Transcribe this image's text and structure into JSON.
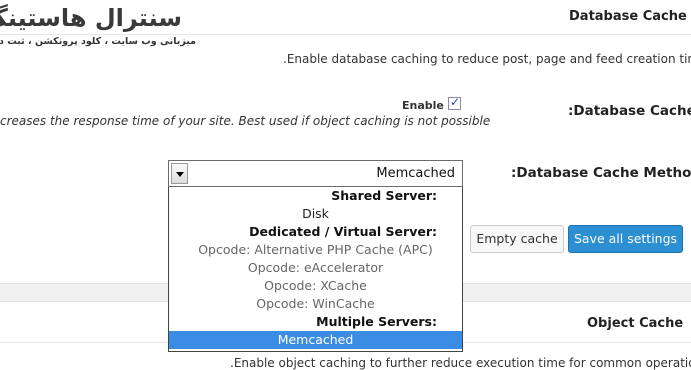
{
  "logo": {
    "main": "سنترال هاستینگ",
    "sub": "میزبانی وب سایت ، کلود پرونکشن ، ثبت دامین"
  },
  "database_cache": {
    "title": "Database Cache",
    "intro": ".Enable database caching to reduce post, page and feed creation time",
    "enable_field_label": ":Database Cache",
    "enable_checkbox_label": "Enable",
    "enable_checked": true,
    "enable_hint": "creases the response time of your site. Best used if object caching is not possible",
    "method_field_label": ":Database Cache Method",
    "method_selected": "Memcached",
    "method_options": [
      {
        "type": "group",
        "label": ":Shared Server"
      },
      {
        "type": "item",
        "label": "Disk",
        "enabled": true
      },
      {
        "type": "group",
        "label": ":Dedicated / Virtual Server"
      },
      {
        "type": "item",
        "label": "(Opcode: Alternative PHP Cache (APC",
        "enabled": false
      },
      {
        "type": "item",
        "label": "Opcode: eAccelerator",
        "enabled": false
      },
      {
        "type": "item",
        "label": "Opcode: XCache",
        "enabled": false
      },
      {
        "type": "item",
        "label": "Opcode: WinCache",
        "enabled": false
      },
      {
        "type": "group",
        "label": ":Multiple Servers"
      },
      {
        "type": "item",
        "label": "Memcached",
        "enabled": true,
        "selected": true
      }
    ]
  },
  "buttons": {
    "empty_cache": "Empty cache",
    "save_all": "Save all settings"
  },
  "object_cache": {
    "title": "Object Cache",
    "intro": ".Enable object caching to further reduce execution time for common operations"
  },
  "colors": {
    "primary_button": "#2b8fd2",
    "selected_option": "#3b8de4"
  }
}
